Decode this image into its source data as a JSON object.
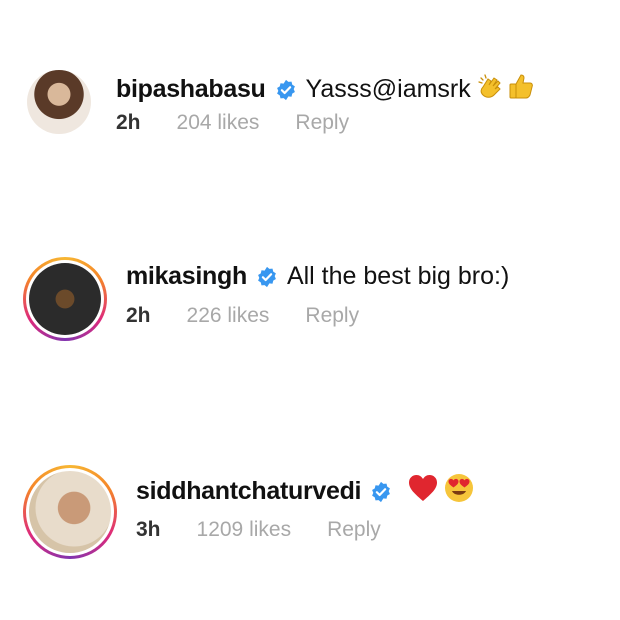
{
  "comments": [
    {
      "username": "bipashabasu",
      "text": "Yasss ",
      "mention": "@iamsrk",
      "time": "2h",
      "likes": "204 likes",
      "reply": "Reply",
      "emojis": [
        "clapping-hands-icon",
        "thumbs-up-icon"
      ]
    },
    {
      "username": "mikasingh",
      "text": "All the best big bro:)",
      "time": "2h",
      "likes": "226 likes",
      "reply": "Reply"
    },
    {
      "username": "siddhantchaturvedi",
      "text": "",
      "time": "3h",
      "likes": "1209 likes",
      "reply": "Reply",
      "emojis": [
        "red-heart-icon",
        "heart-eyes-icon"
      ]
    }
  ],
  "colors": {
    "verified": "#3897f0",
    "muted": "#a8a8a8",
    "text": "#111111"
  }
}
